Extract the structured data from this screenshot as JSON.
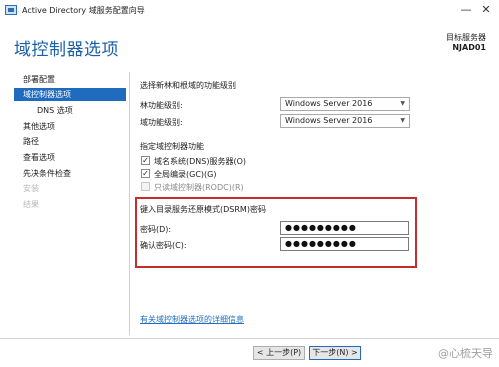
{
  "window": {
    "title": "Active Directory 域服务配置向导",
    "minimize": "—",
    "close": "✕"
  },
  "header": {
    "page_title": "域控制器选项",
    "server_label": "目标服务器",
    "server_name": "NJAD01"
  },
  "nav": {
    "items": [
      {
        "label": "部署配置",
        "state": "normal"
      },
      {
        "label": "域控制器选项",
        "state": "active"
      },
      {
        "label": "DNS 选项",
        "state": "normal"
      },
      {
        "label": "其他选项",
        "state": "normal"
      },
      {
        "label": "路径",
        "state": "normal"
      },
      {
        "label": "查看选项",
        "state": "normal"
      },
      {
        "label": "先决条件检查",
        "state": "normal"
      },
      {
        "label": "安装",
        "state": "disabled"
      },
      {
        "label": "结果",
        "state": "disabled"
      }
    ]
  },
  "main": {
    "functional_level_heading": "选择新林和根域的功能级别",
    "forest_level_label": "林功能级别:",
    "forest_level_value": "Windows Server 2016",
    "domain_level_label": "域功能级别:",
    "domain_level_value": "Windows Server 2016",
    "capabilities_heading": "指定域控制器功能",
    "capabilities": [
      {
        "label": "域名系统(DNS)服务器(O)",
        "checked": true,
        "enabled": true
      },
      {
        "label": "全局编录(GC)(G)",
        "checked": true,
        "enabled": true
      },
      {
        "label": "只读域控制器(RODC)(R)",
        "checked": false,
        "enabled": false
      }
    ],
    "check_glyph": "✓",
    "dsrm_heading": "键入目录服务还原模式(DSRM)密码",
    "password_label": "密码(D):",
    "password_value": "●●●●●●●●●",
    "confirm_label": "确认密码(C):",
    "confirm_value": "●●●●●●●●●",
    "help_link": "有关域控制器选项的详细信息"
  },
  "footer": {
    "back_button": "< 上一步(P)",
    "next_button": "下一步(N) >",
    "watermark": "@心梳天导"
  },
  "colors": {
    "accent": "#1f6cbf",
    "title_blue": "#1a5fa8",
    "highlight_red": "#c42d2d",
    "link": "#1e6fc3"
  },
  "icons": {
    "app": "ad-wizard-icon",
    "dropdown": "chevron-down-icon"
  }
}
